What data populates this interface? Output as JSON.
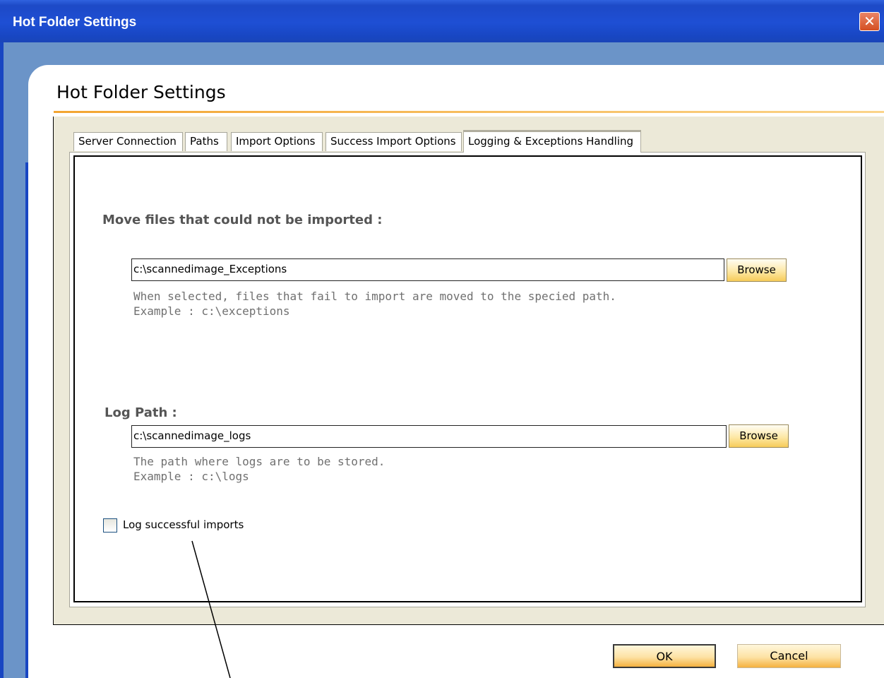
{
  "window": {
    "title": "Hot Folder Settings",
    "close_glyph": "✕"
  },
  "page": {
    "heading": "Hot Folder Settings"
  },
  "tabs": [
    {
      "label": "Server Connection"
    },
    {
      "label": "Paths"
    },
    {
      "label": "Import Options"
    },
    {
      "label": "Success Import Options"
    },
    {
      "label": "Logging & Exceptions Handling"
    }
  ],
  "exceptions": {
    "label": "Move files that could not be imported :",
    "path_value": "c:\\scannedimage_Exceptions",
    "browse_label": "Browse",
    "hint_line1": "When selected, files that fail to import are moved to the specied path.",
    "hint_line2": "Example : c:\\exceptions"
  },
  "logs": {
    "label": "Log Path :",
    "path_value": "c:\\scannedimage_logs",
    "browse_label": "Browse",
    "hint_line1": "The path where logs are to be stored.",
    "hint_line2": "Example : c:\\logs"
  },
  "checkbox": {
    "label": "Log successful imports",
    "checked": false
  },
  "buttons": {
    "ok": "OK",
    "cancel": "Cancel"
  },
  "colors": {
    "title_bar": "#1e4fd4",
    "accent": "#f0a53c",
    "frame_blue": "#6b94c8",
    "tab_area": "#ece9d8"
  },
  "icons": {
    "close": "close-icon",
    "annotation": "annotation-pointer-line"
  }
}
